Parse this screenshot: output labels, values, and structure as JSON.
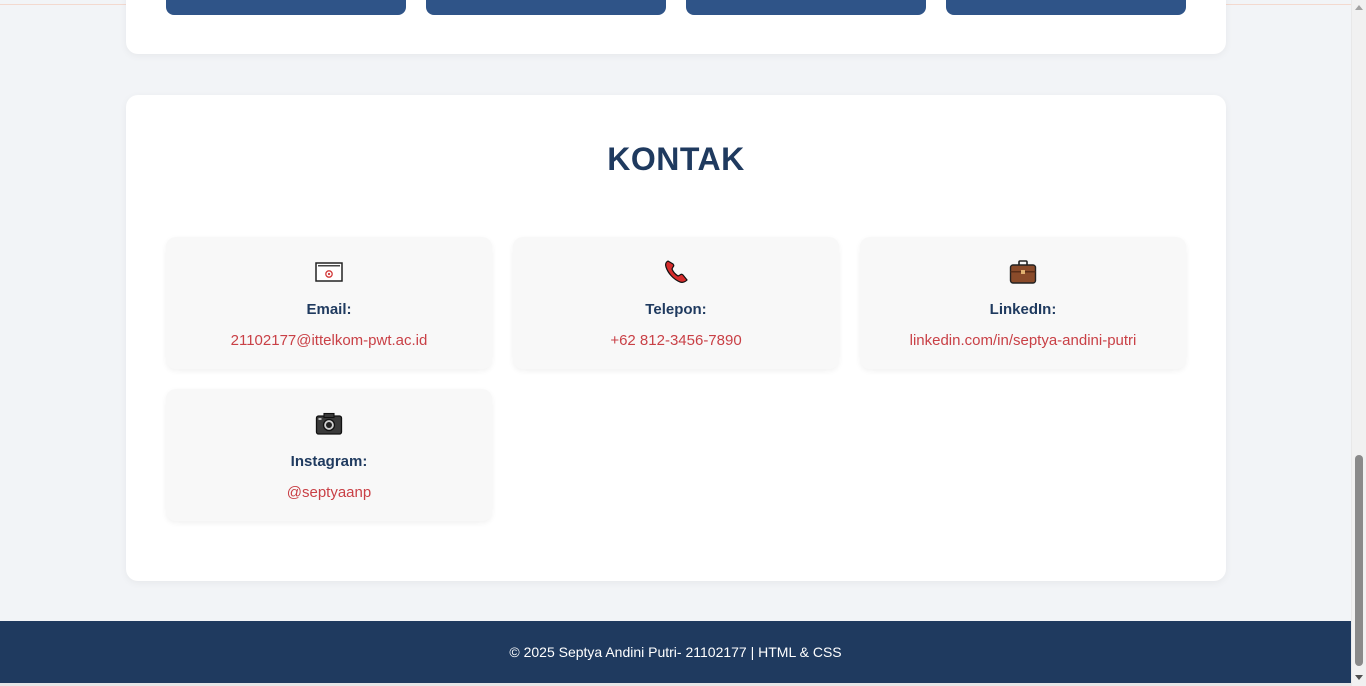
{
  "contact": {
    "title": "KONTAK",
    "items": [
      {
        "icon": "envelope-icon",
        "label": "Email:",
        "value": "21102177@ittelkom-pwt.ac.id"
      },
      {
        "icon": "telephone-icon",
        "label": "Telepon:",
        "value": "+62 812-3456-7890"
      },
      {
        "icon": "briefcase-icon",
        "label": "LinkedIn:",
        "value": "linkedin.com/in/septya-andini-putri"
      },
      {
        "icon": "camera-icon",
        "label": "Instagram:",
        "value": "@septyaanp"
      }
    ]
  },
  "footer": {
    "text": "© 2025 Septya Andini Putri- 21102177 | HTML & CSS"
  },
  "colors": {
    "accent": "#1f3a5f",
    "link": "#c94046",
    "button": "#2f5488"
  }
}
